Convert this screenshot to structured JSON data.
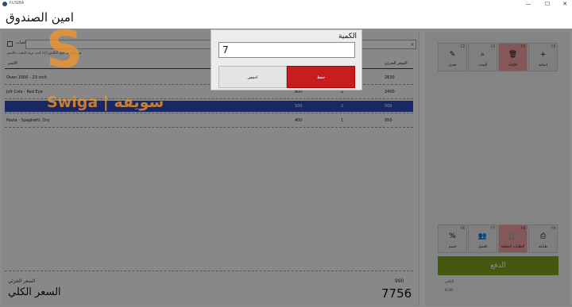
{
  "window": {
    "title": "FUSIBA",
    "minimize": "—",
    "maximize": "☐",
    "close": "✕"
  },
  "header": {
    "title": "امين الصندوق"
  },
  "search": {
    "placeholder": "",
    "icon": "search-icon"
  },
  "barcode_toggle": {
    "label": "الكميات"
  },
  "hint": "في إمكانك فتح الكاميرا إذا كنت تريد البحث بالاسم",
  "table": {
    "columns": {
      "name": "الاسم",
      "unit_price": "السعر الجزئي"
    },
    "rows": [
      {
        "name": "Oven 1000 - 23 inch",
        "total": "",
        "qty": "",
        "unit_price": "2830"
      },
      {
        "name": "Jolt Cola - Red Eye",
        "total": "800",
        "qty": "2",
        "unit_price": "2400"
      },
      {
        "name": "",
        "total": "500",
        "qty": "2",
        "unit_price": "500"
      },
      {
        "name": "Pasta - Spaghetti, Dry",
        "total": "400",
        "qty": "1",
        "unit_price": "950"
      }
    ],
    "selected_index": 2
  },
  "summary": {
    "subtotal_label": "السعر الجزئي",
    "subtotal_value": "990",
    "total_label": "السعر الكلي",
    "total_value": "7756"
  },
  "toolbar_top": [
    {
      "key": "F2",
      "icon": "✎",
      "label": "تعديل",
      "color": ""
    },
    {
      "key": "F3",
      "icon": "⌕",
      "label": "البحث",
      "color": ""
    },
    {
      "key": "F4",
      "icon": "🗑",
      "label": "الإلغاء",
      "color": "#f0a0a0"
    },
    {
      "key": "F5",
      "icon": "+",
      "label": "إضافة",
      "color": ""
    }
  ],
  "toolbar_bottom": [
    {
      "key": "F6",
      "icon": "%",
      "label": "خصم",
      "color": ""
    },
    {
      "key": "F7",
      "icon": "👥",
      "label": "العميل",
      "color": ""
    },
    {
      "key": "F8",
      "icon": "🛒",
      "label": "الطلبات المعلقة",
      "color": "#f0a0a0"
    },
    {
      "key": "F9",
      "icon": "⎙",
      "label": "طباعة",
      "color": ""
    }
  ],
  "pay_button": {
    "label": "الدفع",
    "color": "#7da11c"
  },
  "side_notes": [
    "الباقي",
    "0.00"
  ],
  "watermark": {
    "letter": "S",
    "text": "Swiga | سويقة"
  },
  "dialog": {
    "title": "الكمية",
    "value": "7",
    "cancel_label": "احفض",
    "save_label": "حفظ",
    "save_color": "#c81d1d"
  }
}
